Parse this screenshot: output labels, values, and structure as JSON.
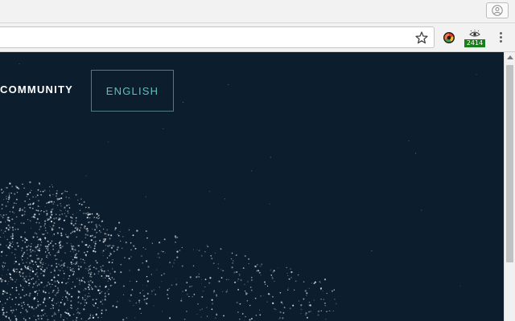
{
  "browser": {
    "profile_icon": "person-icon",
    "bookmark_icon": "star-icon",
    "extension_1_icon": "colorful-circle-icon",
    "extension_2_icon": "eye-icon",
    "extension_2_badge": "2414",
    "menu_icon": "more-vertical-icon"
  },
  "nav": {
    "community_label": "COMMUNITY",
    "language_label": "ENGLISH"
  },
  "colors": {
    "page_background": "#0c1e2e",
    "language_text": "#58c3c3",
    "badge_background": "#1a7f1a"
  }
}
